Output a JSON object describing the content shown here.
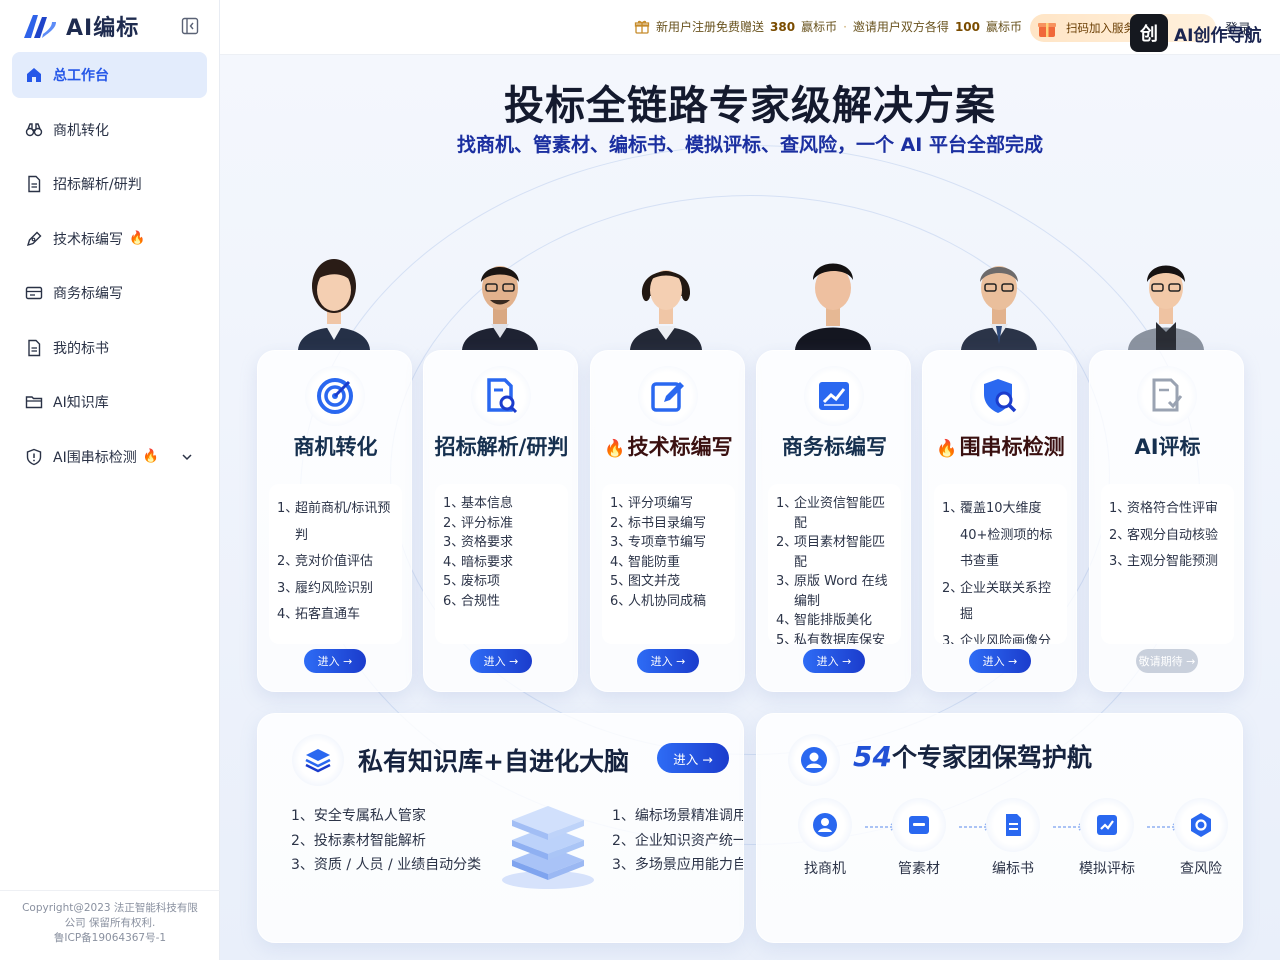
{
  "brand": {
    "name": "AI编标"
  },
  "sidebar": {
    "items": [
      {
        "label": "总工作台",
        "icon": "home-icon",
        "active": true,
        "hot": false
      },
      {
        "label": "商机转化",
        "icon": "binoculars-icon",
        "active": false,
        "hot": false
      },
      {
        "label": "招标解析/研判",
        "icon": "document-icon",
        "active": false,
        "hot": false
      },
      {
        "label": "技术标编写",
        "icon": "pen-icon",
        "active": false,
        "hot": true
      },
      {
        "label": "商务标编写",
        "icon": "mail-icon",
        "active": false,
        "hot": false
      },
      {
        "label": "我的标书",
        "icon": "document-icon",
        "active": false,
        "hot": false
      },
      {
        "label": "AI知识库",
        "icon": "folder-icon",
        "active": false,
        "hot": false
      },
      {
        "label": "AI围串标检测",
        "icon": "shield-icon",
        "active": false,
        "hot": true,
        "expandable": true
      }
    ],
    "copyright": [
      "Copyright@2023 法正智能科技有限",
      "公司 保留所有权利.",
      "鲁ICP备19064367号-1"
    ]
  },
  "topbar": {
    "promo_text1": "新用户注册免费赠送",
    "promo_amount1": "380",
    "promo_unit1": "赢标币",
    "promo_sep": "·",
    "promo_text2": "邀请用户双方各得",
    "promo_amount2": "100",
    "promo_unit2": "赢标币",
    "join_label": "扫码加入服务群",
    "login_label": "登录",
    "overlay_text": "AI创作导航",
    "overlay_glyph": "创"
  },
  "hero": {
    "title": "投标全链路专家级解决方案",
    "subtitle": "找商机、管素材、编标书、模拟评标、查风险，一个 AI 平台全部完成"
  },
  "cards": [
    {
      "title": "商机转化",
      "hot": false,
      "icon": "target-icon",
      "items": [
        "超前商机/标讯预判",
        "竞对价值评估",
        "履约风险识别",
        "拓客直通车"
      ],
      "button": "进入 →",
      "enabled": true
    },
    {
      "title": "招标解析/研判",
      "hot": false,
      "icon": "doc-search-icon",
      "items": [
        "基本信息",
        "评分标准",
        "资格要求",
        "暗标要求",
        "废标项",
        "合规性"
      ],
      "button": "进入 →",
      "enabled": true
    },
    {
      "title": "技术标编写",
      "hot": true,
      "icon": "edit-icon",
      "items": [
        "评分项编写",
        "标书目录编写",
        "专项章节编写",
        "智能防重",
        "图文并茂",
        "人机协同成稿"
      ],
      "button": "进入 →",
      "enabled": true
    },
    {
      "title": "商务标编写",
      "hot": false,
      "icon": "chart-icon",
      "items": [
        "企业资信智能匹配",
        "项目素材智能匹配",
        "原版 Word 在线编制",
        "智能排版美化",
        "私有数据库保安"
      ],
      "button": "进入 →",
      "enabled": true
    },
    {
      "title": "围串标检测",
      "hot": true,
      "icon": "shield-search-icon",
      "items": [
        "覆盖10大维度40+检测项的标书查重",
        "企业关联关系控掘",
        "企业风险画像分"
      ],
      "button": "进入 →",
      "enabled": true
    },
    {
      "title": "AI评标",
      "hot": false,
      "icon": "doc-check-icon",
      "items": [
        "资格符合性评审",
        "客观分自动核验",
        "主观分智能预测"
      ],
      "button": "敬请期待 →",
      "enabled": false
    }
  ],
  "knowledge": {
    "title": "私有知识库+自进化大脑",
    "button": "进入 →",
    "left_items": [
      "安全专属私人管家",
      "投标素材智能解析",
      "资质 / 人员 / 业绩自动分类"
    ],
    "right_items": [
      "编标场景精准调用",
      "企业知识资产统一",
      "多场景应用能力自"
    ]
  },
  "experts": {
    "count": "54",
    "title_suffix": "个专家团保驾护航",
    "steps": [
      "找商机",
      "管素材",
      "编标书",
      "模拟评标",
      "查风险"
    ]
  },
  "colors": {
    "accent": "#2557e8",
    "fire": "#ef4d18",
    "title": "#141a2e",
    "subtitle": "#1b2fa0"
  }
}
